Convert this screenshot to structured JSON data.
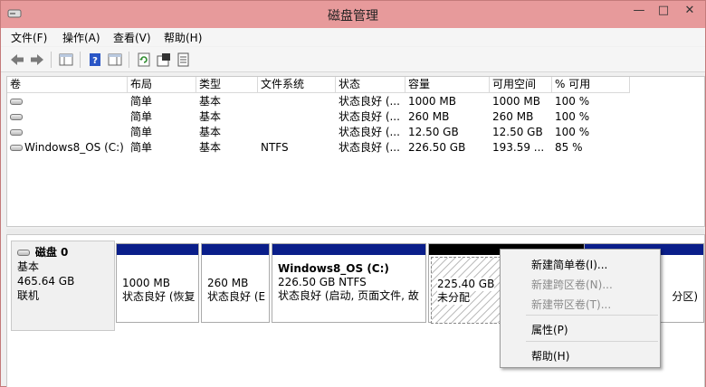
{
  "window": {
    "title": "磁盘管理",
    "min_glyph": "—",
    "max_glyph": "□",
    "close_glyph": "✕"
  },
  "menu": [
    "文件(F)",
    "操作(A)",
    "查看(V)",
    "帮助(H)"
  ],
  "toolbar": {
    "buttons": [
      "back-icon",
      "forward-icon",
      "console-tree-icon",
      "help-icon",
      "properties-panel-icon",
      "refresh-icon",
      "properties-icon",
      "rescan-icon"
    ]
  },
  "volume_table": {
    "columns": [
      "卷",
      "布局",
      "类型",
      "文件系统",
      "状态",
      "容量",
      "可用空间",
      "% 可用"
    ],
    "rows": [
      [
        "",
        "简单",
        "基本",
        "",
        "状态良好 (...",
        "1000 MB",
        "1000 MB",
        "100 %"
      ],
      [
        "",
        "简单",
        "基本",
        "",
        "状态良好 (...",
        "260 MB",
        "260 MB",
        "100 %"
      ],
      [
        "",
        "简单",
        "基本",
        "",
        "状态良好 (...",
        "12.50 GB",
        "12.50 GB",
        "100 %"
      ],
      [
        "Windows8_OS (C:)",
        "简单",
        "基本",
        "NTFS",
        "状态良好 (...",
        "226.50 GB",
        "193.59 ...",
        "85 %"
      ]
    ]
  },
  "disk": {
    "name": "磁盘 0",
    "type": "基本",
    "size": "465.64 GB",
    "status": "联机"
  },
  "partitions": [
    {
      "size": "1000 MB",
      "status": "状态良好 (恢复"
    },
    {
      "size": "260 MB",
      "status": "状态良好 (E"
    },
    {
      "name": "Windows8_OS  (C:)",
      "size": "226.50 GB NTFS",
      "status": "状态良好 (启动, 页面文件, 故"
    },
    {
      "size": "225.40 GB",
      "status": "未分配"
    },
    {
      "status": "分区)"
    }
  ],
  "context_menu": [
    {
      "label": "新建简单卷(I)...",
      "enabled": true
    },
    {
      "label": "新建跨区卷(N)...",
      "enabled": false
    },
    {
      "label": "新建带区卷(T)...",
      "enabled": false
    },
    {
      "label": "属性(P)",
      "enabled": true
    },
    {
      "label": "帮助(H)",
      "enabled": true
    }
  ]
}
